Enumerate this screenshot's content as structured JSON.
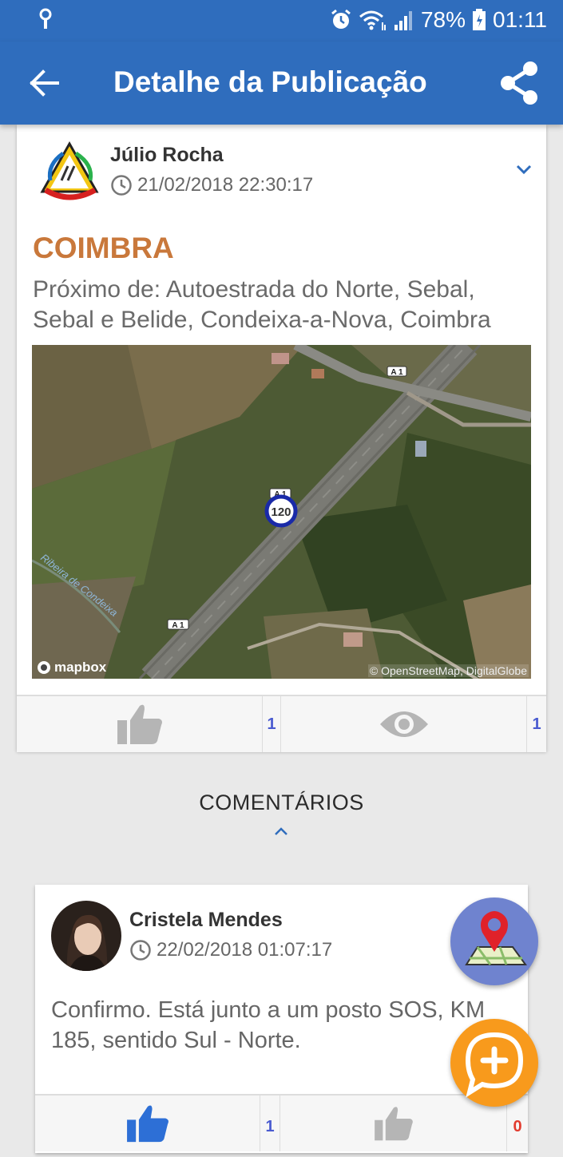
{
  "status_bar": {
    "battery": "78%",
    "time": "01:11",
    "icons": [
      "location-pin-icon",
      "alarm-icon",
      "wifi-icon",
      "signal-icon",
      "battery-icon"
    ]
  },
  "app_bar": {
    "title": "Detalhe da Publicação",
    "icons": [
      "back-arrow-icon",
      "share-icon"
    ]
  },
  "post": {
    "author": "Júlio Rocha",
    "datetime": "21/02/2018 22:30:17",
    "place": "COIMBRA",
    "near_text": "Próximo de: Autoestrada do Norte, Sebal, Sebal e Belide, Condeixa-a-Nova, Coimbra",
    "map": {
      "speed_limit": "120",
      "road_label": "A 1",
      "river_label": "Ribeira de Condeixa",
      "credit_left": "mapbox",
      "credit_right": "© OpenStreetMap, DigitalGlobe"
    },
    "likes": "1",
    "views": "1"
  },
  "comments": {
    "title": "COMENTÁRIOS",
    "items": [
      {
        "author": "Cristela Mendes",
        "datetime": "22/02/2018 01:07:17",
        "text": "Confirmo. Está junto a um posto SOS, KM 185, sentido Sul - Norte.",
        "likes": "1",
        "dislikes": "0"
      }
    ]
  },
  "colors": {
    "primary": "#2f6dbd",
    "place": "#c9783b",
    "count": "#4a5bd0",
    "like_active": "#2d6fd6",
    "fab_map": "#6f83cf",
    "fab_add": "#f89a1c"
  }
}
